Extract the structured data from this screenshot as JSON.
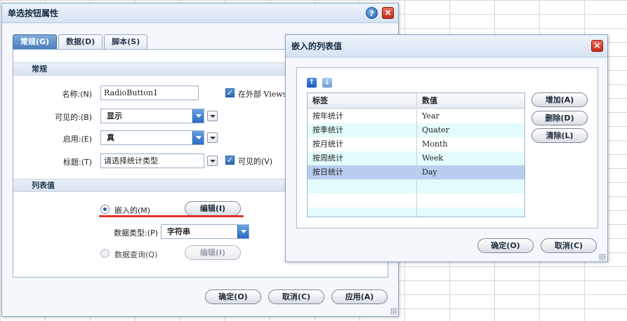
{
  "main_dialog": {
    "title": "单选按钮属性",
    "tabs": [
      {
        "label": "常规(G)"
      },
      {
        "label": "数据(D)"
      },
      {
        "label": "脚本(S)"
      }
    ],
    "general_section": "常规",
    "name_label": "名称:(N)",
    "name_value": "RadioButton1",
    "external_checkbox_label": "在外部 Viewsh",
    "visible_label": "可见的:(B)",
    "visible_value": "显示",
    "enabled_label": "启用:(E)",
    "enabled_value": "真",
    "caption_label": "标题:(T)",
    "caption_value": "请选择统计类型",
    "caption_visible_label": "可见的(V)",
    "list_section": "列表值",
    "embedded_radio_label": "嵌入的(M)",
    "edit_button_1": "编辑(I)",
    "data_type_label": "数据类型:(P)",
    "data_type_value": "字符串",
    "query_radio_label": "数据查询(Q)",
    "edit_button_2": "编辑(I)",
    "ok_button": "确定(O)",
    "cancel_button": "取消(C)",
    "apply_button": "应用(A)"
  },
  "embedded_dialog": {
    "title": "嵌入的列表值",
    "columns": [
      "标签",
      "数值"
    ],
    "rows": [
      {
        "label": "按年统计",
        "value": "Year"
      },
      {
        "label": "按季统计",
        "value": "Quater"
      },
      {
        "label": "按月统计",
        "value": "Month"
      },
      {
        "label": "按周统计",
        "value": "Week"
      },
      {
        "label": "按日统计",
        "value": "Day"
      }
    ],
    "add_button": "增加(A)",
    "delete_button": "删除(D)",
    "clear_button": "清除(L)",
    "ok_button": "确定(O)",
    "cancel_button": "取消(C)"
  },
  "icons": {
    "help": "?",
    "close": "×",
    "check": "✓",
    "up": "↑",
    "down": "↓"
  }
}
